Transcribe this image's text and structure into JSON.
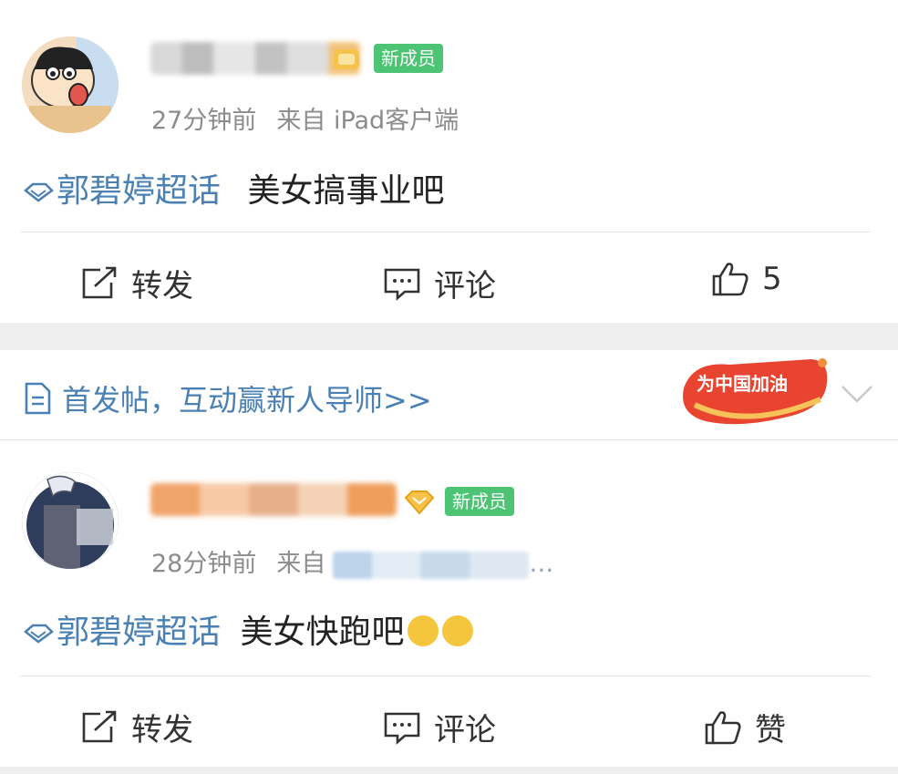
{
  "post1": {
    "member_badge": "新成员",
    "time": "27分钟前",
    "source": "来自 iPad客户端",
    "topic": "郭碧婷超话",
    "text": "美女搞事业吧",
    "actions": {
      "repost": "转发",
      "comment": "评论",
      "like": "5"
    }
  },
  "banner": {
    "text": "首发帖，互动赢新人导师>>",
    "promo_text": "为中国加油"
  },
  "post2": {
    "member_badge": "新成员",
    "time": "28分钟前",
    "source_prefix": "来自",
    "source_tail": "…",
    "topic": "郭碧婷超话",
    "text": "美女快跑吧",
    "actions": {
      "repost": "转发",
      "comment": "评论",
      "like": "赞"
    }
  },
  "icons": [
    "topic-diamond-icon",
    "repost-icon",
    "comment-icon",
    "like-thumb-icon",
    "document-icon",
    "chevron-down-icon",
    "vip-crown-icon",
    "crying-emoji-icon"
  ],
  "colors": {
    "link": "#4a80b3",
    "badge": "#4cc473",
    "muted": "#8c8c8c",
    "separator": "#efefef"
  }
}
